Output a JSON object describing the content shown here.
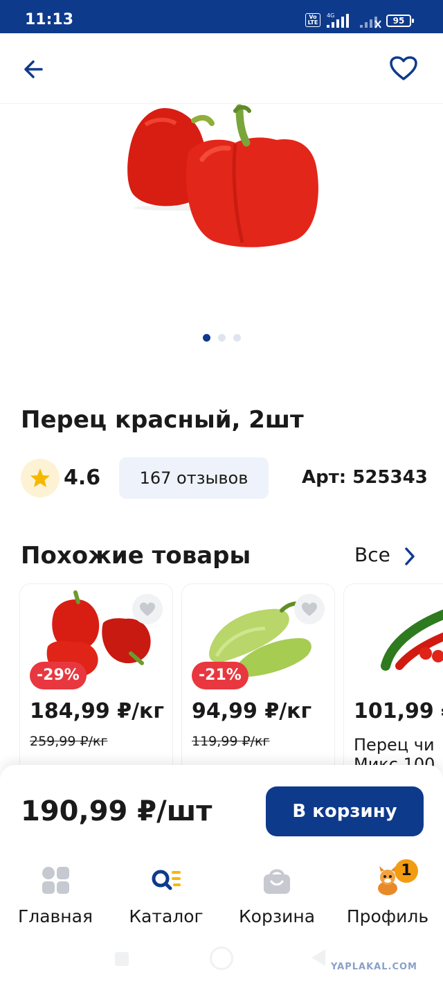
{
  "status_bar": {
    "time": "11:13",
    "volte": "Vo LTE",
    "network": "4G",
    "battery": "95"
  },
  "header": {
    "back_icon": "arrow-left-icon",
    "favorite_icon": "heart-outline-icon"
  },
  "gallery": {
    "image": "red-bell-peppers",
    "pages": 3,
    "current_page": 1
  },
  "product": {
    "title": "Перец красный, 2шт",
    "rating": "4.6",
    "reviews_label": "167 отзывов",
    "article": "Арт: 525343"
  },
  "similar": {
    "title": "Похожие товары",
    "all_label": "Все",
    "items": [
      {
        "image": "red-bell-peppers",
        "discount": "-29%",
        "price": "184,99 ₽/кг",
        "old_price": "259,99 ₽/кг"
      },
      {
        "image": "green-peppers",
        "discount": "-21%",
        "price": "94,99 ₽/кг",
        "old_price": "119,99 ₽/кг"
      },
      {
        "image": "chili-peppers",
        "price": "101,99 ₽",
        "name_line1": "Перец чи",
        "name_line2": "Микс 100"
      }
    ]
  },
  "buy": {
    "price": "190,99 ₽/шт",
    "cart_label": "В корзину"
  },
  "nav": {
    "items": [
      {
        "label": "Главная",
        "icon": "home-grid-icon"
      },
      {
        "label": "Каталог",
        "icon": "catalog-search-icon"
      },
      {
        "label": "Корзина",
        "icon": "shopping-bag-icon"
      },
      {
        "label": "Профиль",
        "icon": "profile-avatar-icon",
        "badge": "1"
      }
    ]
  },
  "watermark": "YAPLAKAL.COM",
  "colors": {
    "brand": "#0e3a8c",
    "discount": "#e8373f",
    "star": "#f5b800"
  }
}
